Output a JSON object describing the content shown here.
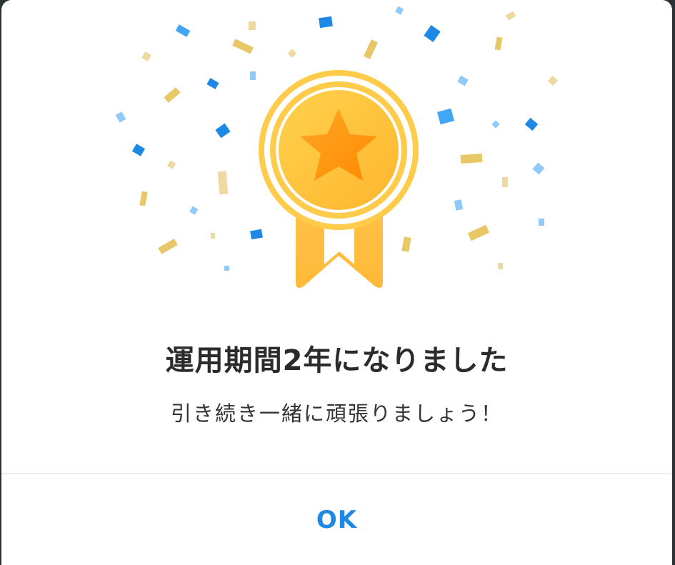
{
  "dialog": {
    "title": "運用期間2年になりました",
    "subtitle": "引き続き一緒に頑張りましょう！",
    "ok_label": "OK"
  },
  "icons": {
    "illustration": "award-medal-with-confetti-icon"
  },
  "colors": {
    "accent": "#1e88e5",
    "medal_gold": "#ffc13b",
    "star_orange": "#ff9100",
    "confetti_blue": "#1e88e5",
    "confetti_light_blue": "#90caf9",
    "confetti_gold": "#e8c766"
  }
}
